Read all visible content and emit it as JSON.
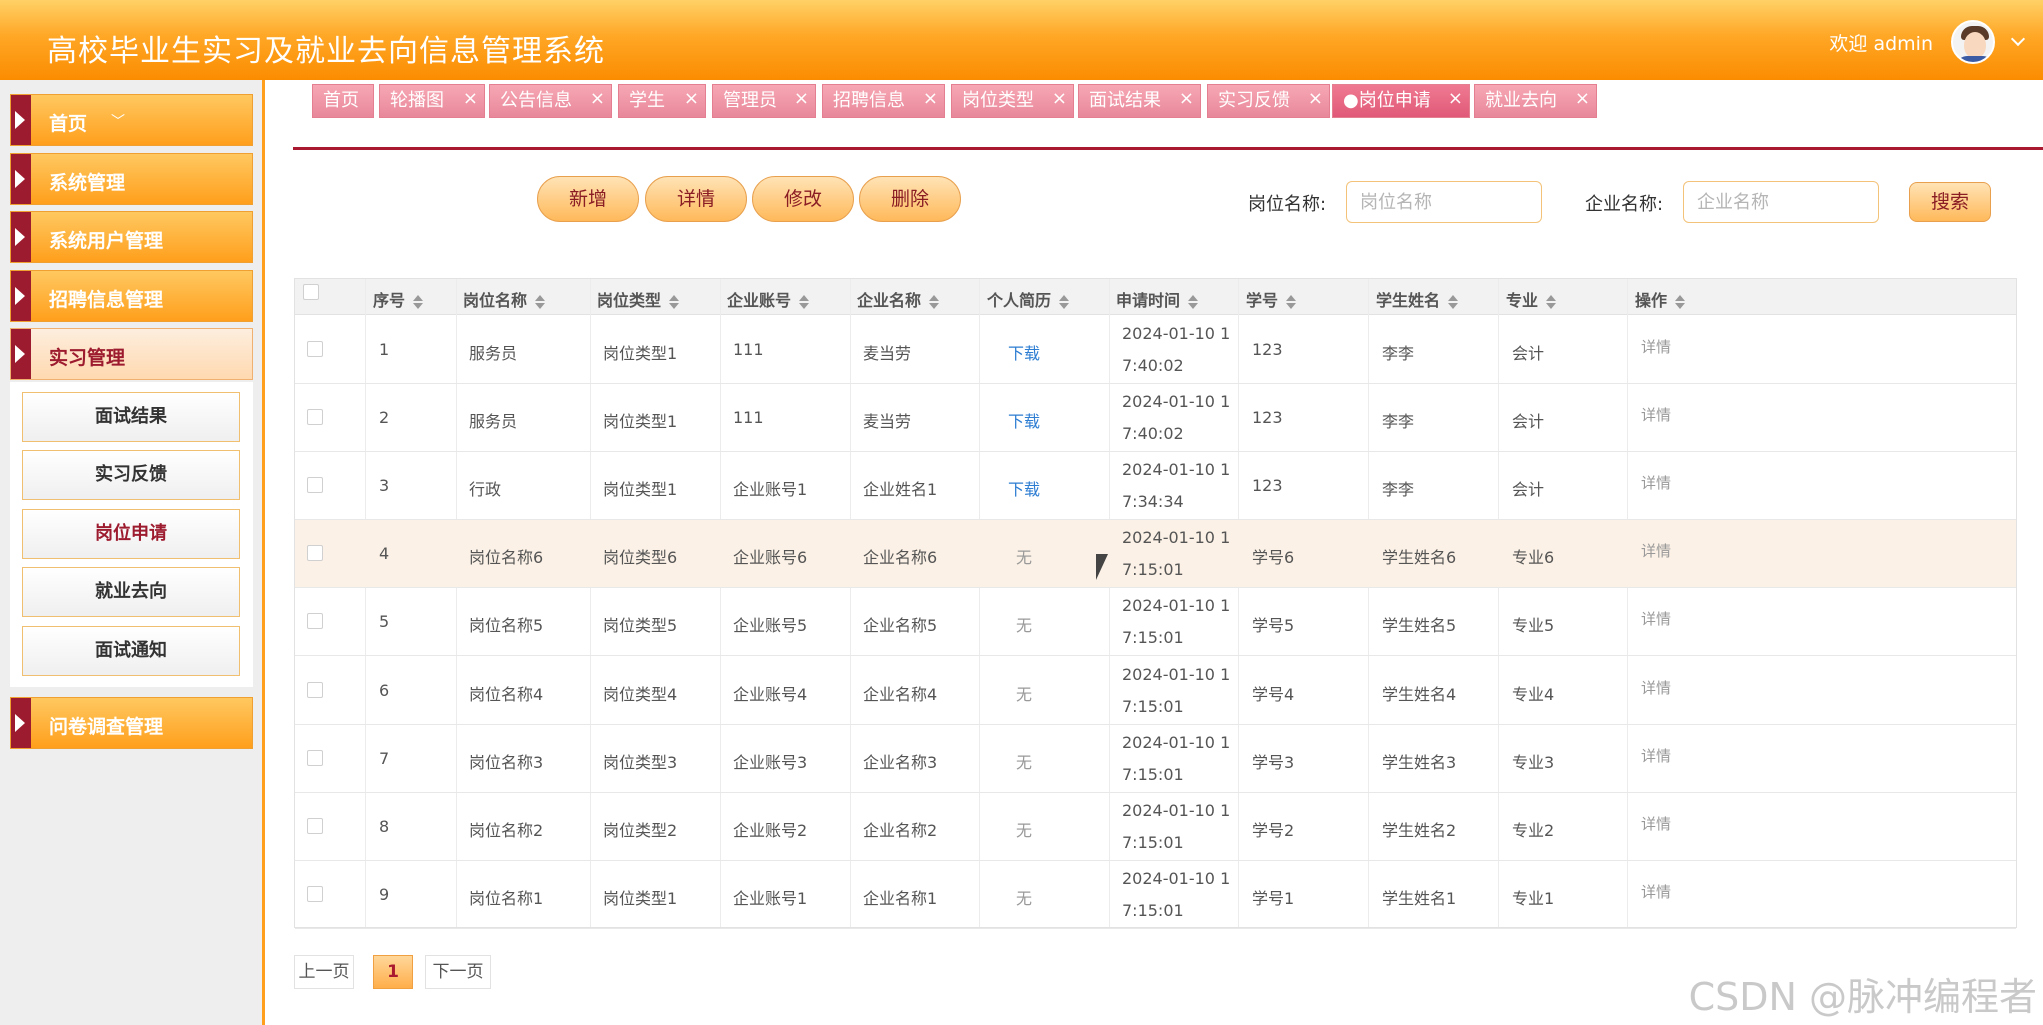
{
  "app": {
    "title": "高校毕业生实习及就业去向信息管理系统"
  },
  "user": {
    "greeting": "欢迎 admin"
  },
  "sidebar": {
    "items": [
      {
        "label": "首页",
        "caret": "﹀"
      },
      {
        "label": "系统管理"
      },
      {
        "label": "系统用户管理"
      },
      {
        "label": "招聘信息管理"
      },
      {
        "label": "实习管理"
      },
      {
        "label": "问卷调查管理"
      }
    ],
    "sub_items": [
      {
        "label": "面试结果"
      },
      {
        "label": "实习反馈"
      },
      {
        "label": "岗位申请"
      },
      {
        "label": "就业去向"
      },
      {
        "label": "面试通知"
      }
    ]
  },
  "tabs": [
    {
      "label": "首页"
    },
    {
      "label": "轮播图"
    },
    {
      "label": "公告信息"
    },
    {
      "label": "学生"
    },
    {
      "label": "管理员"
    },
    {
      "label": "招聘信息"
    },
    {
      "label": "岗位类型"
    },
    {
      "label": "面试结果"
    },
    {
      "label": "实习反馈"
    },
    {
      "label": "●岗位申请"
    },
    {
      "label": "就业去向"
    }
  ],
  "toolbar": {
    "add_label": "新增",
    "detail_label": "详情",
    "edit_label": "修改",
    "delete_label": "删除",
    "search_job_label": "岗位名称:",
    "search_job_placeholder": "岗位名称",
    "search_company_label": "企业名称:",
    "search_company_placeholder": "企业名称",
    "search_button": "搜索"
  },
  "table": {
    "columns": [
      "序号",
      "岗位名称",
      "岗位类型",
      "企业账号",
      "企业名称",
      "个人简历",
      "申请时间",
      "学号",
      "学生姓名",
      "专业",
      "操作"
    ],
    "rows": [
      {
        "no": "1",
        "job": "服务员",
        "type": "岗位类型1",
        "account": "111",
        "company": "麦当劳",
        "resume": "下载",
        "time_1": "2024-01-10 1",
        "time_2": "7:40:02",
        "sid": "123",
        "name": "李李",
        "major": "会计",
        "op": "详情"
      },
      {
        "no": "2",
        "job": "服务员",
        "type": "岗位类型1",
        "account": "111",
        "company": "麦当劳",
        "resume": "下载",
        "time_1": "2024-01-10 1",
        "time_2": "7:40:02",
        "sid": "123",
        "name": "李李",
        "major": "会计",
        "op": "详情"
      },
      {
        "no": "3",
        "job": "行政",
        "type": "岗位类型1",
        "account": "企业账号1",
        "company": "企业姓名1",
        "resume": "下载",
        "time_1": "2024-01-10 1",
        "time_2": "7:34:34",
        "sid": "123",
        "name": "李李",
        "major": "会计",
        "op": "详情"
      },
      {
        "no": "4",
        "job": "岗位名称6",
        "type": "岗位类型6",
        "account": "企业账号6",
        "company": "企业名称6",
        "resume": "无",
        "time_1": "2024-01-10 1",
        "time_2": "7:15:01",
        "sid": "学号6",
        "name": "学生姓名6",
        "major": "专业6",
        "op": "详情"
      },
      {
        "no": "5",
        "job": "岗位名称5",
        "type": "岗位类型5",
        "account": "企业账号5",
        "company": "企业名称5",
        "resume": "无",
        "time_1": "2024-01-10 1",
        "time_2": "7:15:01",
        "sid": "学号5",
        "name": "学生姓名5",
        "major": "专业5",
        "op": "详情"
      },
      {
        "no": "6",
        "job": "岗位名称4",
        "type": "岗位类型4",
        "account": "企业账号4",
        "company": "企业名称4",
        "resume": "无",
        "time_1": "2024-01-10 1",
        "time_2": "7:15:01",
        "sid": "学号4",
        "name": "学生姓名4",
        "major": "专业4",
        "op": "详情"
      },
      {
        "no": "7",
        "job": "岗位名称3",
        "type": "岗位类型3",
        "account": "企业账号3",
        "company": "企业名称3",
        "resume": "无",
        "time_1": "2024-01-10 1",
        "time_2": "7:15:01",
        "sid": "学号3",
        "name": "学生姓名3",
        "major": "专业3",
        "op": "详情"
      },
      {
        "no": "8",
        "job": "岗位名称2",
        "type": "岗位类型2",
        "account": "企业账号2",
        "company": "企业名称2",
        "resume": "无",
        "time_1": "2024-01-10 1",
        "time_2": "7:15:01",
        "sid": "学号2",
        "name": "学生姓名2",
        "major": "专业2",
        "op": "详情"
      },
      {
        "no": "9",
        "job": "岗位名称1",
        "type": "岗位类型1",
        "account": "企业账号1",
        "company": "企业名称1",
        "resume": "无",
        "time_1": "2024-01-10 1",
        "time_2": "7:15:01",
        "sid": "学号1",
        "name": "学生姓名1",
        "major": "专业1",
        "op": "详情"
      }
    ]
  },
  "pagination": {
    "prev": "上一页",
    "current": "1",
    "next": "下一页"
  },
  "watermark": "CSDN @脉冲编程者",
  "colors": {
    "primary": "#ff9f1c",
    "accent": "#a9192f",
    "tab": "#e8889a",
    "link": "#2d7dd2"
  }
}
